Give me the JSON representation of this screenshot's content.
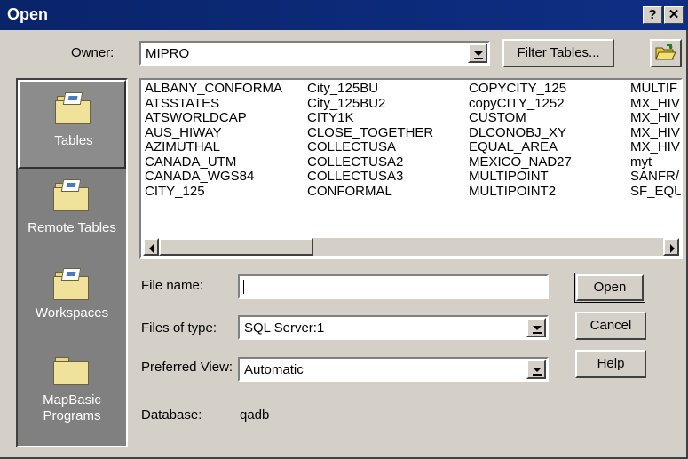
{
  "window": {
    "title": "Open",
    "help_label": "?",
    "close_label": "✕"
  },
  "owner": {
    "label": "Owner:",
    "value": "MIPRO"
  },
  "toolbar": {
    "filter_label": "Filter Tables...",
    "open_icon": "folder-open-icon"
  },
  "places": [
    {
      "label": "Tables",
      "selected": true
    },
    {
      "label": "Remote Tables",
      "selected": false
    },
    {
      "label": "Workspaces",
      "selected": false
    },
    {
      "label_line1": "MapBasic",
      "label_line2": "Programs",
      "selected": false
    }
  ],
  "table_list": {
    "columns": [
      [
        "ALBANY_CONFORMA",
        "ATSSTATES",
        "ATSWORLDCAP",
        "AUS_HIWAY",
        "AZIMUTHAL",
        "CANADA_UTM",
        "CANADA_WGS84",
        "CITY_125"
      ],
      [
        "City_125BU",
        "City_125BU2",
        "CITY1K",
        "CLOSE_TOGETHER",
        "COLLECTUSA",
        "COLLECTUSA2",
        "COLLECTUSA3",
        "CONFORMAL"
      ],
      [
        "COPYCITY_125",
        "copyCITY_1252",
        "CUSTOM",
        "DLCONOBJ_XY",
        "EQUAL_AREA",
        "MEXICO_NAD27",
        "MULTIPOINT",
        "MULTIPOINT2"
      ],
      [
        "MULTIF",
        "MX_HIV",
        "MX_HIV",
        "MX_HIV",
        "MX_HIV",
        "myt",
        "SANFR/",
        "SF_EQU"
      ]
    ]
  },
  "form": {
    "file_name_label": "File name:",
    "file_name_value": "",
    "files_of_type_label": "Files of type:",
    "files_of_type_value": "SQL Server:1",
    "preferred_view_label": "Preferred View:",
    "preferred_view_value": "Automatic",
    "database_label": "Database:",
    "database_value": "qadb"
  },
  "buttons": {
    "open": "Open",
    "cancel": "Cancel",
    "help": "Help"
  }
}
